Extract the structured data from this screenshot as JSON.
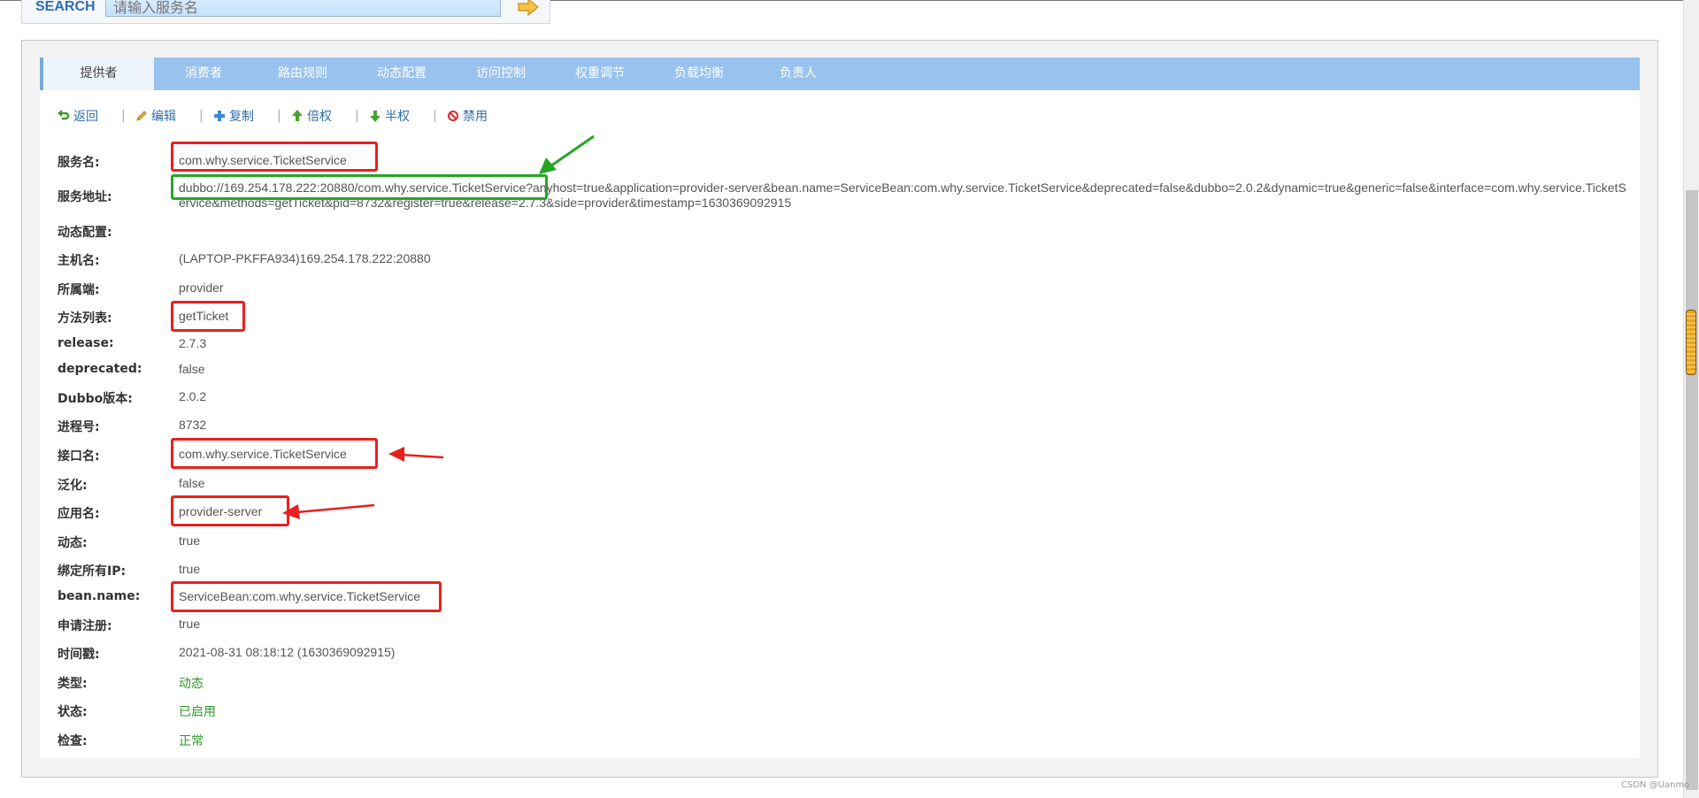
{
  "search": {
    "label": "SEARCH",
    "placeholder": "请输入服务名"
  },
  "tabs": [
    {
      "label": "提供者"
    },
    {
      "label": "消费者"
    },
    {
      "label": "路由规则"
    },
    {
      "label": "动态配置"
    },
    {
      "label": "访问控制"
    },
    {
      "label": "权重调节"
    },
    {
      "label": "负载均衡"
    },
    {
      "label": "负责人"
    }
  ],
  "toolbar": {
    "back": "返回",
    "edit": "编辑",
    "copy": "复制",
    "double": "倍权",
    "half": "半权",
    "disable": "禁用",
    "separator": "|"
  },
  "details": {
    "service_name": {
      "label": "服务名:",
      "value": "com.why.service.TicketService"
    },
    "service_addr": {
      "label": "服务地址:",
      "value": "dubbo://169.254.178.222:20880/com.why.service.TicketService?anyhost=true&application=provider-server&bean.name=ServiceBean:com.why.service.TicketService&deprecated=false&dubbo=2.0.2&dynamic=true&generic=false&interface=com.why.service.TicketService&methods=getTicket&pid=8732&register=true&release=2.7.3&side=provider&timestamp=1630369092915"
    },
    "dynamic_config": {
      "label": "动态配置:",
      "value": ""
    },
    "host": {
      "label": "主机名:",
      "value": "(LAPTOP-PKFFA934)169.254.178.222:20880"
    },
    "side": {
      "label": "所属端:",
      "value": "provider"
    },
    "methods": {
      "label": "方法列表:",
      "value": "getTicket"
    },
    "release": {
      "label": "release:",
      "value": "2.7.3"
    },
    "deprecated": {
      "label": "deprecated:",
      "value": "false"
    },
    "dubbo_version": {
      "label": "Dubbo版本:",
      "value": "2.0.2"
    },
    "pid": {
      "label": "进程号:",
      "value": "8732"
    },
    "interface": {
      "label": "接口名:",
      "value": "com.why.service.TicketService"
    },
    "generic": {
      "label": "泛化:",
      "value": "false"
    },
    "application": {
      "label": "应用名:",
      "value": "provider-server"
    },
    "dynamic": {
      "label": "动态:",
      "value": "true"
    },
    "anyhost": {
      "label": "绑定所有IP:",
      "value": "true"
    },
    "bean_name": {
      "label": "bean.name:",
      "value": "ServiceBean:com.why.service.TicketService"
    },
    "register": {
      "label": "申请注册:",
      "value": "true"
    },
    "timestamp": {
      "label": "时间戳:",
      "value": "2021-08-31 08:18:12 (1630369092915)"
    },
    "type": {
      "label": "类型:",
      "value": "动态"
    },
    "status": {
      "label": "状态:",
      "value": "已启用"
    },
    "check": {
      "label": "检查:",
      "value": "正常"
    }
  },
  "watermark": "CSDN @Uanmo",
  "colors": {
    "tab_bar": "#99c2ee",
    "link": "#2f6ea8",
    "annotation_red": "#e8201d",
    "annotation_green": "#25a525",
    "status_green": "#2b9a27"
  },
  "icons": [
    "arrow-return-icon",
    "pencil-icon",
    "plus-icon",
    "arrow-up-icon",
    "arrow-down-icon",
    "forbidden-icon",
    "search-go-icon"
  ]
}
